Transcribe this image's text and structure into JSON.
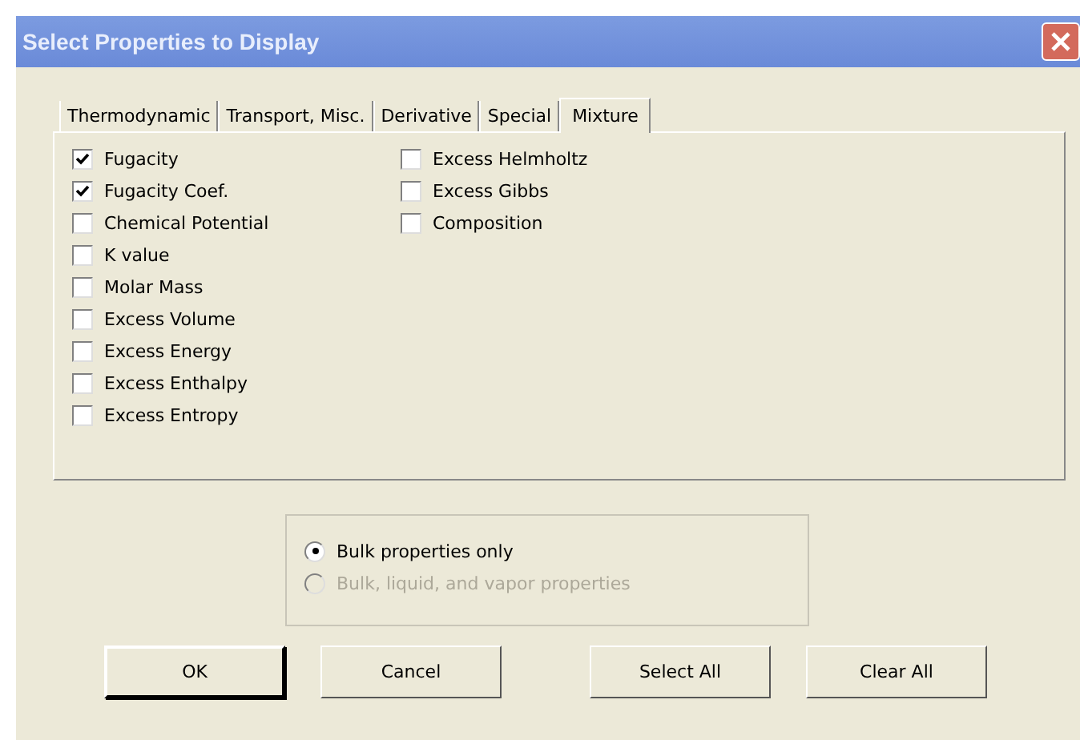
{
  "window": {
    "title": "Select Properties to Display"
  },
  "tabs": [
    {
      "label": "Thermodynamic",
      "selected": false
    },
    {
      "label": "Transport, Misc.",
      "selected": false
    },
    {
      "label": "Derivative",
      "selected": false
    },
    {
      "label": "Special",
      "selected": false
    },
    {
      "label": "Mixture",
      "selected": true
    }
  ],
  "columns": [
    [
      {
        "label": "Fugacity",
        "checked": true
      },
      {
        "label": "Fugacity Coef.",
        "checked": true
      },
      {
        "label": "Chemical Potential",
        "checked": false
      },
      {
        "label": "K value",
        "checked": false
      },
      {
        "label": "Molar Mass",
        "checked": false
      },
      {
        "label": "Excess Volume",
        "checked": false
      },
      {
        "label": "Excess Energy",
        "checked": false
      },
      {
        "label": "Excess Enthalpy",
        "checked": false
      },
      {
        "label": "Excess Entropy",
        "checked": false
      }
    ],
    [
      {
        "label": "Excess Helmholtz",
        "checked": false
      },
      {
        "label": "Excess Gibbs",
        "checked": false
      },
      {
        "label": "Composition",
        "checked": false
      }
    ]
  ],
  "options": [
    {
      "label": "Bulk properties only",
      "selected": true,
      "disabled": false
    },
    {
      "label": "Bulk, liquid, and vapor properties",
      "selected": false,
      "disabled": true
    }
  ],
  "buttons": [
    {
      "label": "OK",
      "default": true
    },
    {
      "label": "Cancel",
      "default": false
    },
    {
      "label": "Select All",
      "default": false
    },
    {
      "label": "Clear All",
      "default": false
    }
  ]
}
